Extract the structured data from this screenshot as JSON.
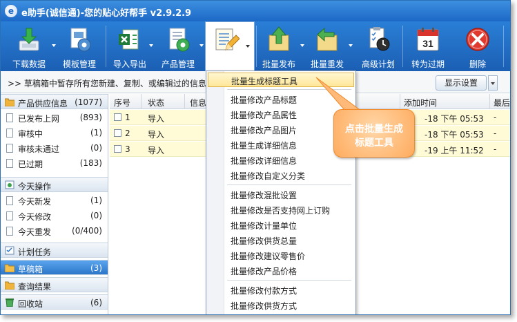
{
  "window": {
    "title": "e助手(诚信通)-您的贴心好帮手 v2.9.2.9",
    "logo": "e"
  },
  "toolbar": {
    "buttons": [
      {
        "label": "下载数据",
        "icon": "download-icon"
      },
      {
        "label": "模板管理",
        "icon": "template-icon"
      },
      {
        "label": "导入导出",
        "icon": "excel-icon"
      },
      {
        "label": "产品管理",
        "icon": "product-icon"
      },
      {
        "label": "",
        "icon": "batch-edit-icon"
      },
      {
        "label": "批量发布",
        "icon": "batch-publish-icon"
      },
      {
        "label": "批量重发",
        "icon": "batch-repost-icon"
      },
      {
        "label": "高级计划",
        "icon": "schedule-icon"
      },
      {
        "label": "转为过期",
        "icon": "calendar-icon"
      },
      {
        "label": "删除",
        "icon": "delete-icon"
      }
    ],
    "calendar_day": "31"
  },
  "infobar": {
    "text": ">> 草稿箱中暂存所有您新建、复制、或编辑过的信息",
    "display_settings": "显示设置"
  },
  "sidebar": {
    "groups": [
      {
        "label": "产品供应信息",
        "count": "(1077)",
        "icon": "folder-icon",
        "items": [
          {
            "label": "已发布上网",
            "count": "(893)"
          },
          {
            "label": "审核中",
            "count": "(1)"
          },
          {
            "label": "审核未通过",
            "count": "(0)"
          },
          {
            "label": "已过期",
            "count": "(183)"
          }
        ]
      },
      {
        "label": "今天操作",
        "count": "",
        "icon": "today-icon",
        "items": [
          {
            "label": "今天新发",
            "count": "(1)"
          },
          {
            "label": "今天修改",
            "count": "(0)"
          },
          {
            "label": "今天重发",
            "count": "(0/400)"
          }
        ]
      },
      {
        "label": "计划任务",
        "count": "",
        "icon": "task-icon",
        "items": []
      },
      {
        "label": "草稿箱",
        "count": "(3)",
        "icon": "drafts-icon",
        "items": []
      },
      {
        "label": "查询结果",
        "count": "",
        "icon": "search-results-icon",
        "items": []
      },
      {
        "label": "回收站",
        "count": "(6)",
        "icon": "recycle-bin-icon",
        "items": []
      }
    ]
  },
  "grid": {
    "columns": [
      "序号",
      "状态",
      "信息",
      "添加时间",
      "最后"
    ],
    "rows": [
      {
        "no": "1",
        "status": "导入",
        "time": "-18 下午 05:53",
        "last": "-"
      },
      {
        "no": "2",
        "status": "导入",
        "time": "-18 下午 05:53",
        "last": "-"
      },
      {
        "no": "3",
        "status": "导入",
        "time": "-19 上午 11:52",
        "last": "-"
      }
    ]
  },
  "menu": {
    "items": [
      "批量生成标题工具",
      "批量修改产品标题",
      "批量修改产品属性",
      "批量修改产品图片",
      "批量生成详细信息",
      "批量修改详细信息",
      "批量修改自定义分类",
      "批量修改混批设置",
      "批量修改是否支持网上订购",
      "批量修改计量单位",
      "批量修改供货总量",
      "批量修改建议零售价",
      "批量修改产品价格",
      "批量修改付款方式",
      "批量修改供货方式"
    ],
    "highlighted_index": 0
  },
  "callout": {
    "line1": "点击批量生成",
    "line2": "标题工具",
    "color": "#ffab5e"
  },
  "colors": {
    "toolbar": "#1f66bd",
    "selected_row": "#fffbd6",
    "sidebar_selected": "#2b76c9"
  }
}
